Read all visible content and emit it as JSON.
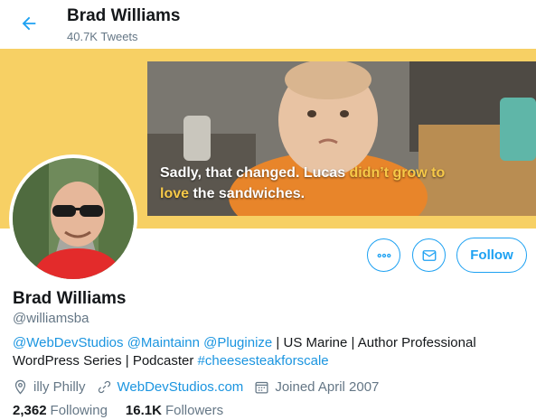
{
  "header": {
    "title": "Brad Williams",
    "tweet_count": "40.7K Tweets"
  },
  "banner": {
    "caption_part1": "Sadly, that changed. Lucas ",
    "caption_highlight1": "didn’t grow to",
    "caption_highlight2": "love",
    "caption_part2": " the sandwiches."
  },
  "actions": {
    "follow_label": "Follow"
  },
  "profile": {
    "name": "Brad Williams",
    "handle": "@williamsba"
  },
  "bio": {
    "mention1": "@WebDevStudios",
    "mention2": "@Maintainn",
    "mention3": "@Pluginize",
    "text1": " | US Marine | Author Professional WordPress Series | Podcaster ",
    "hashtag": "#cheesesteakforscale"
  },
  "meta": {
    "location": "illy Philly",
    "website": "WebDevStudios.com",
    "joined": "Joined April 2007"
  },
  "stats": {
    "following_count": "2,362",
    "following_label": "Following",
    "followers_count": "16.1K",
    "followers_label": "Followers"
  },
  "colors": {
    "accent": "#1da1f2",
    "banner_bg": "#f7d064",
    "caption_highlight": "#f7c948",
    "muted_text": "#657786"
  },
  "icons": [
    "back-arrow-icon",
    "more-icon",
    "mail-icon",
    "location-icon",
    "link-icon",
    "calendar-icon"
  ]
}
